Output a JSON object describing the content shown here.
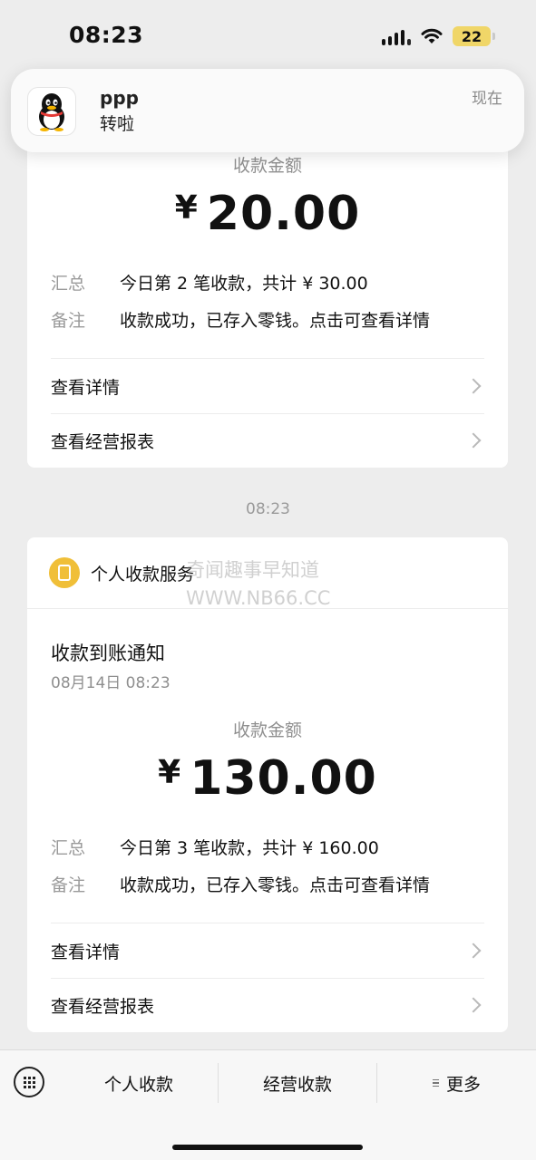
{
  "status_bar": {
    "time": "08:23",
    "battery": "22",
    "icons": [
      "cellular-signal-icon",
      "wifi-icon",
      "battery-icon"
    ]
  },
  "notification": {
    "app_icon": "qq-penguin-icon",
    "title": "ppp",
    "body": "转啦",
    "time": "现在"
  },
  "card1": {
    "amount_label": "收款金额",
    "currency": "¥",
    "amount": "20.00",
    "summary_key": "汇总",
    "summary_value": "今日第 2 笔收款，共计 ¥ 30.00",
    "note_key": "备注",
    "note_value": "收款成功，已存入零钱。点击可查看详情",
    "link_details": "查看详情",
    "link_report": "查看经营报表"
  },
  "chat_time": "08:23",
  "watermark": {
    "line1": "奇闻趣事早知道",
    "line2": "WWW.NB66.CC"
  },
  "card2": {
    "service_icon": "personal-payment-icon",
    "service_name": "个人收款服务",
    "notice_title": "收款到账通知",
    "notice_date": "08月14日 08:23",
    "amount_label": "收款金额",
    "currency": "¥",
    "amount": "130.00",
    "summary_key": "汇总",
    "summary_value": "今日第 3 笔收款，共计 ¥ 160.00",
    "note_key": "备注",
    "note_value": "收款成功，已存入零钱。点击可查看详情",
    "link_details": "查看详情",
    "link_report": "查看经营报表"
  },
  "bottom_menu": {
    "keyboard_icon": "keyboard-icon",
    "tabs": [
      "个人收款",
      "经营收款",
      "更多"
    ]
  },
  "colors": {
    "background": "#ededed",
    "card": "#ffffff",
    "service_icon": "#f0bf38",
    "battery": "#f0d668"
  }
}
